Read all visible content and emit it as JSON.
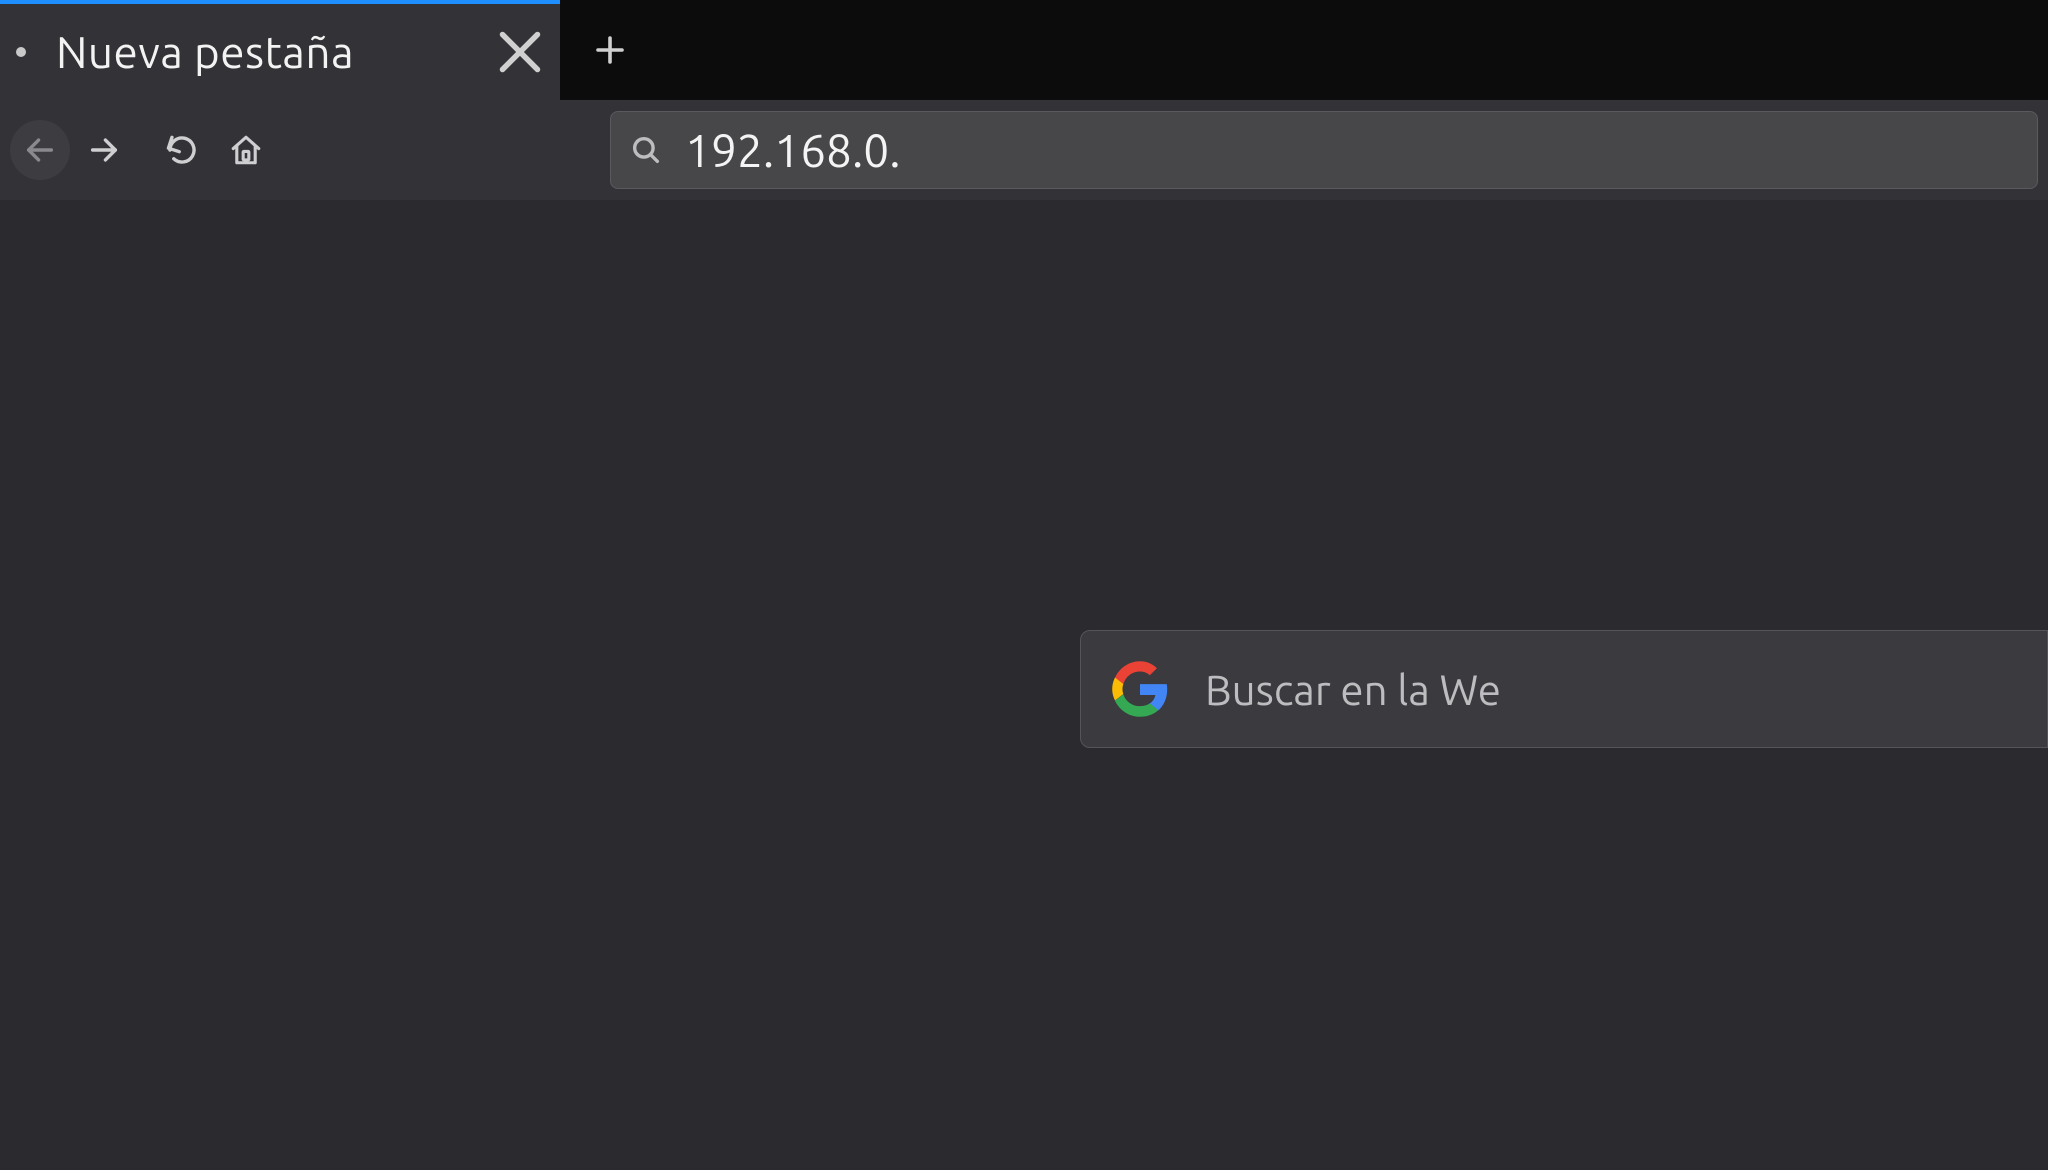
{
  "tabs": {
    "active": {
      "title": "Nueva pestaña"
    }
  },
  "urlbar": {
    "value": "192.168.0."
  },
  "page_search": {
    "placeholder": "Buscar en la We"
  },
  "colors": {
    "accent": "#1f8fff",
    "toolbar_bg": "#333237",
    "content_bg": "#2b2a2f"
  }
}
